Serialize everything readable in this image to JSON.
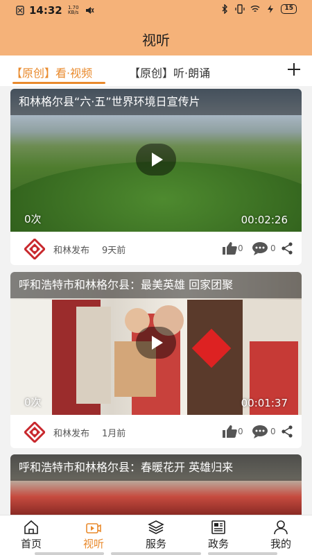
{
  "status_bar": {
    "time": "14:32",
    "net_speed": "1.70",
    "net_unit": "KB/s",
    "battery": "15"
  },
  "header": {
    "title": "视听"
  },
  "tabs": [
    {
      "label": "【原创】看·视频",
      "active": true
    },
    {
      "label": "【原创】听·朗诵",
      "active": false
    }
  ],
  "feed": [
    {
      "title": "和林格尔县“六·五”世界环境日宣传片",
      "views": "0次",
      "duration": "00:02:26",
      "publisher": "和林发布",
      "time_ago": "9天前",
      "likes": "0",
      "comments": "0"
    },
    {
      "title": "呼和浩特市和林格尔县：最美英雄 回家团聚",
      "views": "0次",
      "duration": "00:01:37",
      "publisher": "和林发布",
      "time_ago": "1月前",
      "likes": "0",
      "comments": "0"
    },
    {
      "title": "呼和浩特市和林格尔县：春暖花开 英雄归来"
    }
  ],
  "bottom_nav": [
    {
      "label": "首页",
      "icon": "home-icon",
      "active": false
    },
    {
      "label": "视听",
      "icon": "video-icon",
      "active": true
    },
    {
      "label": "服务",
      "icon": "layers-icon",
      "active": false
    },
    {
      "label": "政务",
      "icon": "newspaper-icon",
      "active": false
    },
    {
      "label": "我的",
      "icon": "user-icon",
      "active": false
    }
  ],
  "colors": {
    "header_bg": "#f5b279",
    "accent": "#e98a2c",
    "publisher_logo": "#c8282d"
  }
}
